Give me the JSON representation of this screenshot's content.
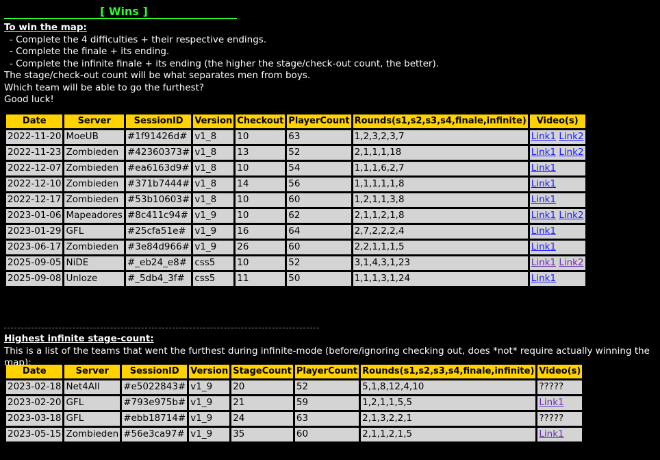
{
  "wins": {
    "title": "[ Wins ]",
    "subheading": "To win the map:",
    "bullets": [
      "- Complete the 4 difficulties + their respective endings.",
      "- Complete the finale + its ending.",
      "- Complete the infinite finale + its ending (the higher the stage/check-out count, the better)."
    ],
    "lines": [
      "The stage/check-out count will be what separates men from boys.",
      "Which team will be able to go the furthest?",
      "Good luck!"
    ],
    "headers": [
      "Date",
      "Server",
      "SessionID",
      "Version",
      "Checkout",
      "PlayerCount",
      "Rounds(s1,s2,s3,s4,finale,infinite)",
      "Video(s)"
    ],
    "rows": [
      {
        "date": "2022-11-20",
        "server": "MoeUB",
        "session": "#1f91426d#",
        "version": "v1_8",
        "count": "10",
        "players": "63",
        "rounds": "1,2,3,2,3,7",
        "link1": "Link1",
        "link2": "Link2"
      },
      {
        "date": "2022-11-23",
        "server": "Zombieden",
        "session": "#42360373#",
        "version": "v1_8",
        "count": "13",
        "players": "52",
        "rounds": "2,1,1,1,18",
        "link1": "Link1",
        "link2": "Link2"
      },
      {
        "date": "2022-12-07",
        "server": "Zombieden",
        "session": "#ea6163d9#",
        "version": "v1_8",
        "count": "10",
        "players": "54",
        "rounds": "1,1,1,6,2,7",
        "link1": "Link1",
        "link2": ""
      },
      {
        "date": "2022-12-10",
        "server": "Zombieden",
        "session": "#371b7444#",
        "version": "v1_8",
        "count": "14",
        "players": "56",
        "rounds": "1,1,1,1,1,8",
        "link1": "Link1",
        "link2": ""
      },
      {
        "date": "2022-12-17",
        "server": "Zombieden",
        "session": "#53b10603#",
        "version": "v1_8",
        "count": "10",
        "players": "60",
        "rounds": "1,2,1,1,3,8",
        "link1": "Link1",
        "link2": ""
      },
      {
        "date": "2023-01-06",
        "server": "Mapeadores",
        "session": "#8c411c94#",
        "version": "v1_9",
        "count": "10",
        "players": "62",
        "rounds": "2,1,1,2,1,8",
        "link1": "Link1",
        "link2": "Link2"
      },
      {
        "date": "2023-01-29",
        "server": "GFL",
        "session": "#25cfa51e#",
        "version": "v1_9",
        "count": "16",
        "players": "64",
        "rounds": "2,7,2,2,2,4",
        "link1": "Link1",
        "link2": ""
      },
      {
        "date": "2023-06-17",
        "server": "Zombieden",
        "session": "#3e84d966#",
        "version": "v1_9",
        "count": "26",
        "players": "60",
        "rounds": "2,2,1,1,1,5",
        "link1": "Link1",
        "link2": ""
      },
      {
        "date": "2025-09-05",
        "server": "NiDE",
        "session": "#_eb24_e8#",
        "version": "css5",
        "count": "10",
        "players": "52",
        "rounds": "3,1,4,3,1,23",
        "link1": "Link1",
        "link2": "Link2"
      },
      {
        "date": "2025-09-08",
        "server": "Unloze",
        "session": "#_5db4_3f#",
        "version": "css5",
        "count": "11",
        "players": "50",
        "rounds": "1,1,1,3,1,24",
        "link1": "Link1",
        "link2": ""
      }
    ]
  },
  "divider": "--------------------------------------------------------------------------------------------------------",
  "infinite": {
    "subheading": "Highest infinite stage-count:",
    "description": "This is a list of the teams that went the furthest during infinite-mode (before/ignoring checking out, does *not* require actually winning the map):",
    "headers": [
      "Date",
      "Server",
      "SessionID",
      "Version",
      "StageCount",
      "PlayerCount",
      "Rounds(s1,s2,s3,s4,finale,infinite)",
      "Video(s)"
    ],
    "rows": [
      {
        "date": "2023-02-18",
        "server": "Net4All",
        "session": "#e5022843#",
        "version": "v1_9",
        "count": "20",
        "players": "52",
        "rounds": "5,1,8,12,4,10",
        "video": "?????",
        "link1": ""
      },
      {
        "date": "2023-02-20",
        "server": "GFL",
        "session": "#793e975b#",
        "version": "v1_9",
        "count": "21",
        "players": "59",
        "rounds": "1,2,1,1,5,5",
        "video": "",
        "link1": "Link1"
      },
      {
        "date": "2023-03-18",
        "server": "GFL",
        "session": "#ebb18714#",
        "version": "v1_9",
        "count": "24",
        "players": "63",
        "rounds": "2,1,3,2,2,1",
        "video": "?????",
        "link1": ""
      },
      {
        "date": "2023-05-15",
        "server": "Zombieden",
        "session": "#56e3ca97#",
        "version": "v1_9",
        "count": "35",
        "players": "60",
        "rounds": "2,1,1,2,1,5",
        "video": "",
        "link1": "Link1"
      }
    ]
  },
  "colors": {
    "background": "#000000",
    "title": "#2cff2c",
    "header": "#ffd200",
    "cell": "#d4d4d4",
    "link": "#1a1aff",
    "visited_link": "#6a2fb0"
  }
}
